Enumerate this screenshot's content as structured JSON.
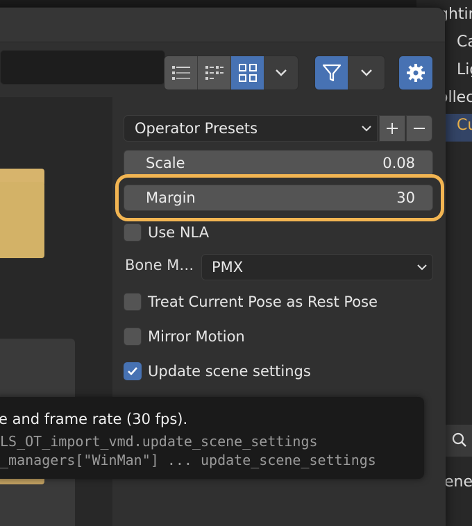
{
  "outliner": {
    "rows": [
      "ghtin",
      "Ca",
      "Lig",
      "ollec",
      "Cu"
    ],
    "scene_label": "ene"
  },
  "toolbar": {
    "view_buttons": [
      "vertical-list-icon",
      "horizontal-list-icon",
      "thumbnails-icon"
    ],
    "filter_icon": "filter-icon",
    "settings_icon": "gear-icon"
  },
  "operator": {
    "presets_label": "Operator Presets",
    "scale_label": "Scale",
    "scale_value": "0.08",
    "margin_label": "Margin",
    "margin_value": "30",
    "use_nla_label": "Use NLA",
    "use_nla_checked": false,
    "bone_mapper_label": "Bone M…",
    "bone_mapper_value": "PMX",
    "treat_pose_label": "Treat Current Pose as Rest Pose",
    "treat_pose_checked": false,
    "mirror_label": "Mirror Motion",
    "mirror_checked": false,
    "update_scene_label": "Update scene settings",
    "update_scene_checked": true
  },
  "tooltip": {
    "line1": "e and frame rate (30 fps).",
    "line2": "LS_OT_import_vmd.update_scene_settings",
    "line3": "_managers[\"WinMan\"] ... update_scene_settings"
  },
  "colors": {
    "accent": "#4772b3",
    "highlight": "#f2b552",
    "folder": "#d3b267"
  }
}
